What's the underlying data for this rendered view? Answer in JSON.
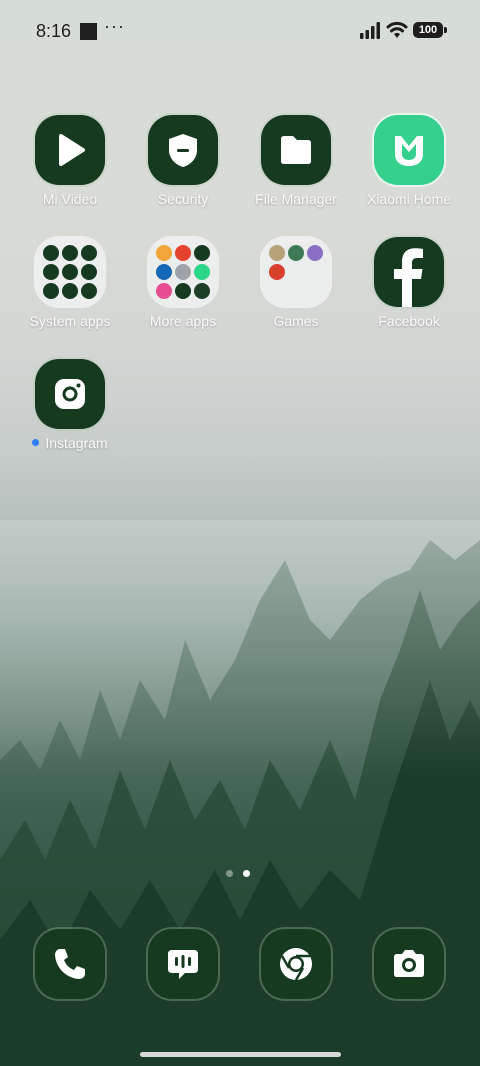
{
  "status_bar": {
    "time": "8:16",
    "more": "···",
    "battery": "100"
  },
  "apps": [
    {
      "label": "Mi Video"
    },
    {
      "label": "Security"
    },
    {
      "label": "File Manager"
    },
    {
      "label": "Xiaomi Home"
    },
    {
      "label": "System apps"
    },
    {
      "label": "More apps"
    },
    {
      "label": "Games"
    },
    {
      "label": "Facebook"
    },
    {
      "label": "Instagram"
    }
  ],
  "pager": {
    "pages": 2,
    "current": 2
  },
  "dock": {
    "phone": "phone-icon",
    "messages": "messages-icon",
    "chrome": "chrome-icon",
    "camera": "camera-icon"
  },
  "colors": {
    "icon_bg": "#153a1f",
    "xiaomi_green": "#36d08e",
    "new_dot": "#2e7cf6"
  }
}
